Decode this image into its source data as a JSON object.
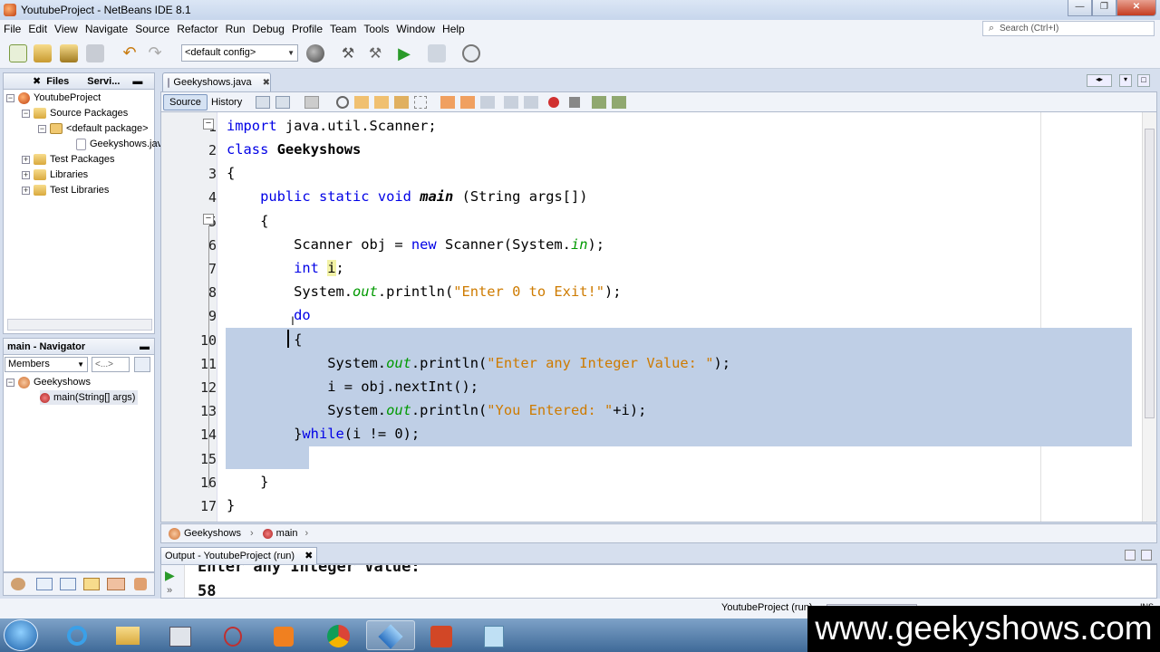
{
  "window": {
    "title": "YoutubeProject - NetBeans IDE 8.1",
    "minimize": "—",
    "restore": "❐",
    "close": "✕"
  },
  "menu": [
    "File",
    "Edit",
    "View",
    "Navigate",
    "Source",
    "Refactor",
    "Run",
    "Debug",
    "Profile",
    "Team",
    "Tools",
    "Window",
    "Help"
  ],
  "search": {
    "placeholder": "Search (Ctrl+I)"
  },
  "toolbar": {
    "config": "<default config>"
  },
  "projects_panel": {
    "tabs": [
      "Files",
      "Servi..."
    ],
    "tree": [
      {
        "label": "YoutubeProject",
        "icon": "project-icon"
      },
      {
        "label": "Source Packages",
        "icon": "folder-icon"
      },
      {
        "label": "<default package>",
        "icon": "package-icon"
      },
      {
        "label": "Geekyshows.java",
        "icon": "java-file-icon"
      },
      {
        "label": "Test Packages",
        "icon": "folder-icon"
      },
      {
        "label": "Libraries",
        "icon": "folder-icon"
      },
      {
        "label": "Test Libraries",
        "icon": "folder-icon"
      }
    ]
  },
  "navigator": {
    "title": "main - Navigator",
    "filter": "Members",
    "filter2": "<empty>",
    "tree": [
      {
        "label": "Geekyshows"
      },
      {
        "label": "main(String[] args)"
      }
    ]
  },
  "editor": {
    "tab": "Geekyshows.java",
    "source_tab": "Source",
    "history_tab": "History",
    "line_numbers": [
      "1",
      "2",
      "3",
      "4",
      "5",
      "6",
      "7",
      "8",
      "9",
      "10",
      "11",
      "12",
      "13",
      "14",
      "15",
      "16",
      "17"
    ]
  },
  "breadcrumb": {
    "class": "Geekyshows",
    "method": "main"
  },
  "output": {
    "tab": "Output - YoutubeProject (run)",
    "lines": [
      "Enter any Integer Value:",
      "58"
    ]
  },
  "status": {
    "project": "YoutubeProject (run)",
    "mode": "INS"
  },
  "watermark": "www.geekyshows.com"
}
